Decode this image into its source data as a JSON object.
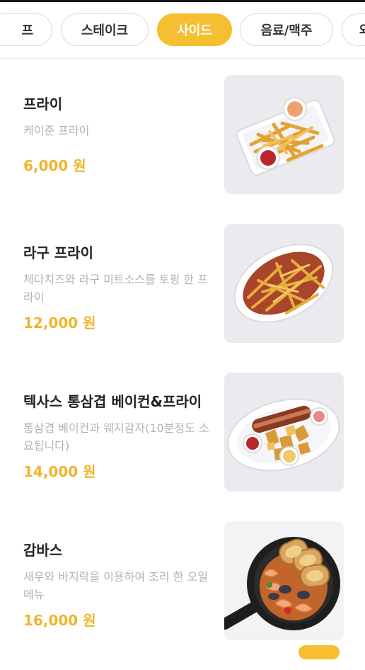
{
  "tabs": [
    {
      "label": "프",
      "active": false
    },
    {
      "label": "스테이크",
      "active": false
    },
    {
      "label": "사이드",
      "active": true
    },
    {
      "label": "음료/맥주",
      "active": false
    },
    {
      "label": "와",
      "active": false
    }
  ],
  "items": [
    {
      "name": "프라이",
      "desc": "케이준 프라이",
      "price": "6,000 원",
      "photo_icon": "fries-tray-photo"
    },
    {
      "name": "라구 프라이",
      "desc": "체다치즈와 라구 미트소스를 토핑 한 프라이",
      "price": "12,000 원",
      "photo_icon": "ragu-fries-photo"
    },
    {
      "name": "텍사스 통삼겹 베이컨&프라이",
      "desc": "통삼겹 베이컨과 웨지감자(10분정도 소요됩니다)",
      "price": "14,000 원",
      "photo_icon": "bacon-fries-photo"
    },
    {
      "name": "감바스",
      "desc": "새우와 바지락을 이용하여 조리 한 오일 메뉴",
      "price": "16,000 원",
      "photo_icon": "gambas-pan-photo"
    }
  ],
  "colors": {
    "accent": "#f6bf32",
    "price": "#f0b42c",
    "name": "#222222",
    "desc": "#b3b3b3"
  }
}
